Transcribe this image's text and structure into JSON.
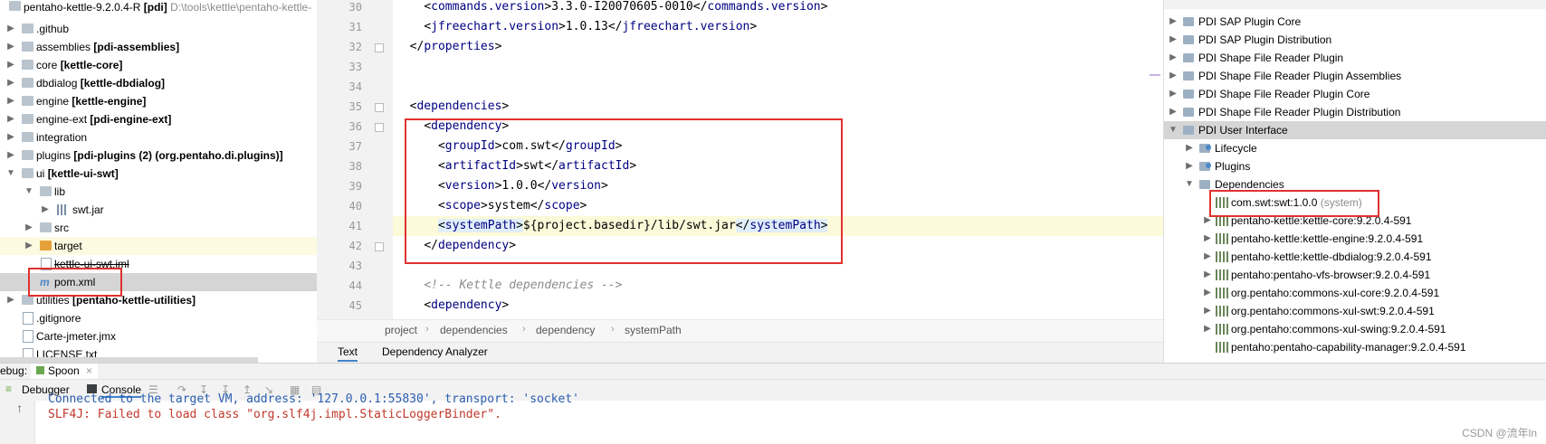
{
  "project": {
    "root": {
      "name": "pentaho-kettle-9.2.0.4-R",
      "module": "[pdi]",
      "path": "D:\\tools\\kettle\\pentaho-kettle-"
    },
    "items": [
      {
        "name": ".github",
        "module": ""
      },
      {
        "name": "assemblies",
        "module": "[pdi-assemblies]"
      },
      {
        "name": "core",
        "module": "[kettle-core]"
      },
      {
        "name": "dbdialog",
        "module": "[kettle-dbdialog]"
      },
      {
        "name": "engine",
        "module": "[kettle-engine]"
      },
      {
        "name": "engine-ext",
        "module": "[pdi-engine-ext]"
      },
      {
        "name": "integration",
        "module": ""
      },
      {
        "name": "plugins",
        "module": "[pdi-plugins (2) (org.pentaho.di.plugins)]"
      },
      {
        "name": "ui",
        "module": "[kettle-ui-swt]"
      },
      {
        "name": "lib",
        "module": ""
      },
      {
        "name": "swt.jar",
        "module": ""
      },
      {
        "name": "src",
        "module": ""
      },
      {
        "name": "target",
        "module": ""
      },
      {
        "name": "kettle-ui-swt.iml",
        "module": ""
      },
      {
        "name": "pom.xml",
        "module": ""
      },
      {
        "name": "utilities",
        "module": "[pentaho-kettle-utilities]"
      },
      {
        "name": ".gitignore",
        "module": ""
      },
      {
        "name": "Carte-jmeter.jmx",
        "module": ""
      },
      {
        "name": "LICENSE.txt",
        "module": ""
      }
    ]
  },
  "editor": {
    "lines": [
      {
        "no": "30",
        "indent": "    ",
        "open": "commands.version",
        "text": "3.3.0-I20070605-0010",
        "close": "commands.version"
      },
      {
        "no": "31",
        "indent": "    ",
        "open": "jfreechart.version",
        "text": "1.0.13",
        "close": "jfreechart.version"
      },
      {
        "no": "32",
        "indent": "  ",
        "close_only": "properties"
      },
      {
        "no": "33"
      },
      {
        "no": "34"
      },
      {
        "no": "35",
        "indent": "  ",
        "open_only": "dependencies"
      },
      {
        "no": "36",
        "indent": "    ",
        "open_only": "dependency"
      },
      {
        "no": "37",
        "indent": "      ",
        "open": "groupId",
        "text": "com.swt",
        "close": "groupId"
      },
      {
        "no": "38",
        "indent": "      ",
        "open": "artifactId",
        "text": "swt",
        "close": "artifactId"
      },
      {
        "no": "39",
        "indent": "      ",
        "open": "version",
        "text": "1.0.0",
        "close": "version"
      },
      {
        "no": "40",
        "indent": "      ",
        "open": "scope",
        "text": "system",
        "close": "scope"
      },
      {
        "no": "41",
        "indent": "      ",
        "open": "systemPath",
        "text": "${project.basedir}/lib/swt.jar",
        "close": "systemPath"
      },
      {
        "no": "42",
        "indent": "    ",
        "close_only": "dependency"
      },
      {
        "no": "43"
      },
      {
        "no": "44",
        "indent": "    ",
        "comment": "<!-- Kettle dependencies -->"
      },
      {
        "no": "45",
        "indent": "    ",
        "open_only": "dependency"
      }
    ],
    "breadcrumb": [
      "project",
      "dependencies",
      "dependency",
      "systemPath"
    ],
    "tabs": [
      "Text",
      "Dependency Analyzer"
    ]
  },
  "maven": {
    "items": [
      {
        "label": "PDI SAP Plugin Core"
      },
      {
        "label": "PDI SAP Plugin Distribution"
      },
      {
        "label": "PDI Shape File Reader Plugin"
      },
      {
        "label": "PDI Shape File Reader Plugin Assemblies"
      },
      {
        "label": "PDI Shape File Reader Plugin Core"
      },
      {
        "label": "PDI Shape File Reader Plugin Distribution"
      },
      {
        "label": "PDI User Interface"
      },
      {
        "label": "Lifecycle"
      },
      {
        "label": "Plugins"
      },
      {
        "label": "Dependencies"
      },
      {
        "label": "com.swt:swt:1.0.0",
        "suffix": "(system)"
      },
      {
        "label": "pentaho-kettle:kettle-core:9.2.0.4-591"
      },
      {
        "label": "pentaho-kettle:kettle-engine:9.2.0.4-591"
      },
      {
        "label": "pentaho-kettle:kettle-dbdialog:9.2.0.4-591"
      },
      {
        "label": "pentaho:pentaho-vfs-browser:9.2.0.4-591"
      },
      {
        "label": "org.pentaho:commons-xul-core:9.2.0.4-591"
      },
      {
        "label": "org.pentaho:commons-xul-swt:9.2.0.4-591"
      },
      {
        "label": "org.pentaho:commons-xul-swing:9.2.0.4-591"
      },
      {
        "label": "pentaho:pentaho-capability-manager:9.2.0.4-591"
      }
    ]
  },
  "debug": {
    "label": "ebug:",
    "run_tab": "Spoon",
    "tabs": [
      "Debugger",
      "Console"
    ],
    "console_lines": [
      "Connected to the target VM, address: '127.0.0.1:55830', transport: 'socket'",
      "SLF4J: Failed to load class \"org.slf4j.impl.StaticLoggerBinder\"."
    ]
  },
  "watermark": "CSDN @流年ln",
  "colors": {
    "accent": "#4083c9",
    "annotation": "#e0312f",
    "xml_tag": "#000080"
  }
}
